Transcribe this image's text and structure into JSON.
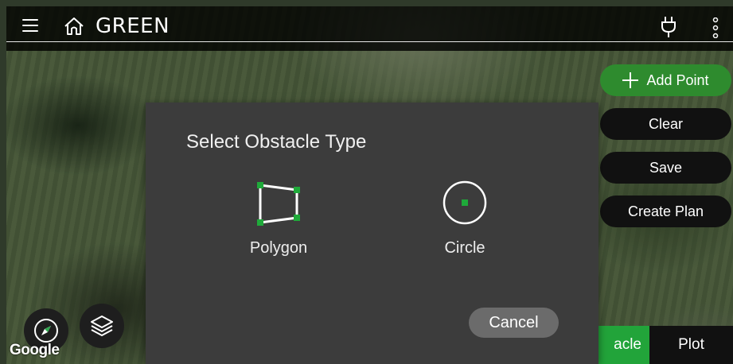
{
  "app": {
    "title": "GREEN"
  },
  "topbar": {
    "menu_icon": "menu-icon",
    "home_icon": "home-icon",
    "plug_icon": "plug-icon",
    "more_icon": "more-vertical-icon"
  },
  "side_buttons": {
    "add_point": "Add Point",
    "clear": "Clear",
    "save": "Save",
    "create_plan": "Create Plan"
  },
  "bottom_tabs": {
    "obstacle": "acle",
    "plot": "Plot"
  },
  "map": {
    "attribution": "Google"
  },
  "dialog": {
    "title": "Select Obstacle Type",
    "options": [
      {
        "label": "Polygon",
        "icon": "polygon-icon"
      },
      {
        "label": "Circle",
        "icon": "circle-icon"
      }
    ],
    "cancel": "Cancel"
  },
  "colors": {
    "accent_green": "#2e8b2e",
    "tab_green": "#22a43a",
    "dialog_bg": "#3c3c3c",
    "handle_green": "#1faa3a"
  }
}
